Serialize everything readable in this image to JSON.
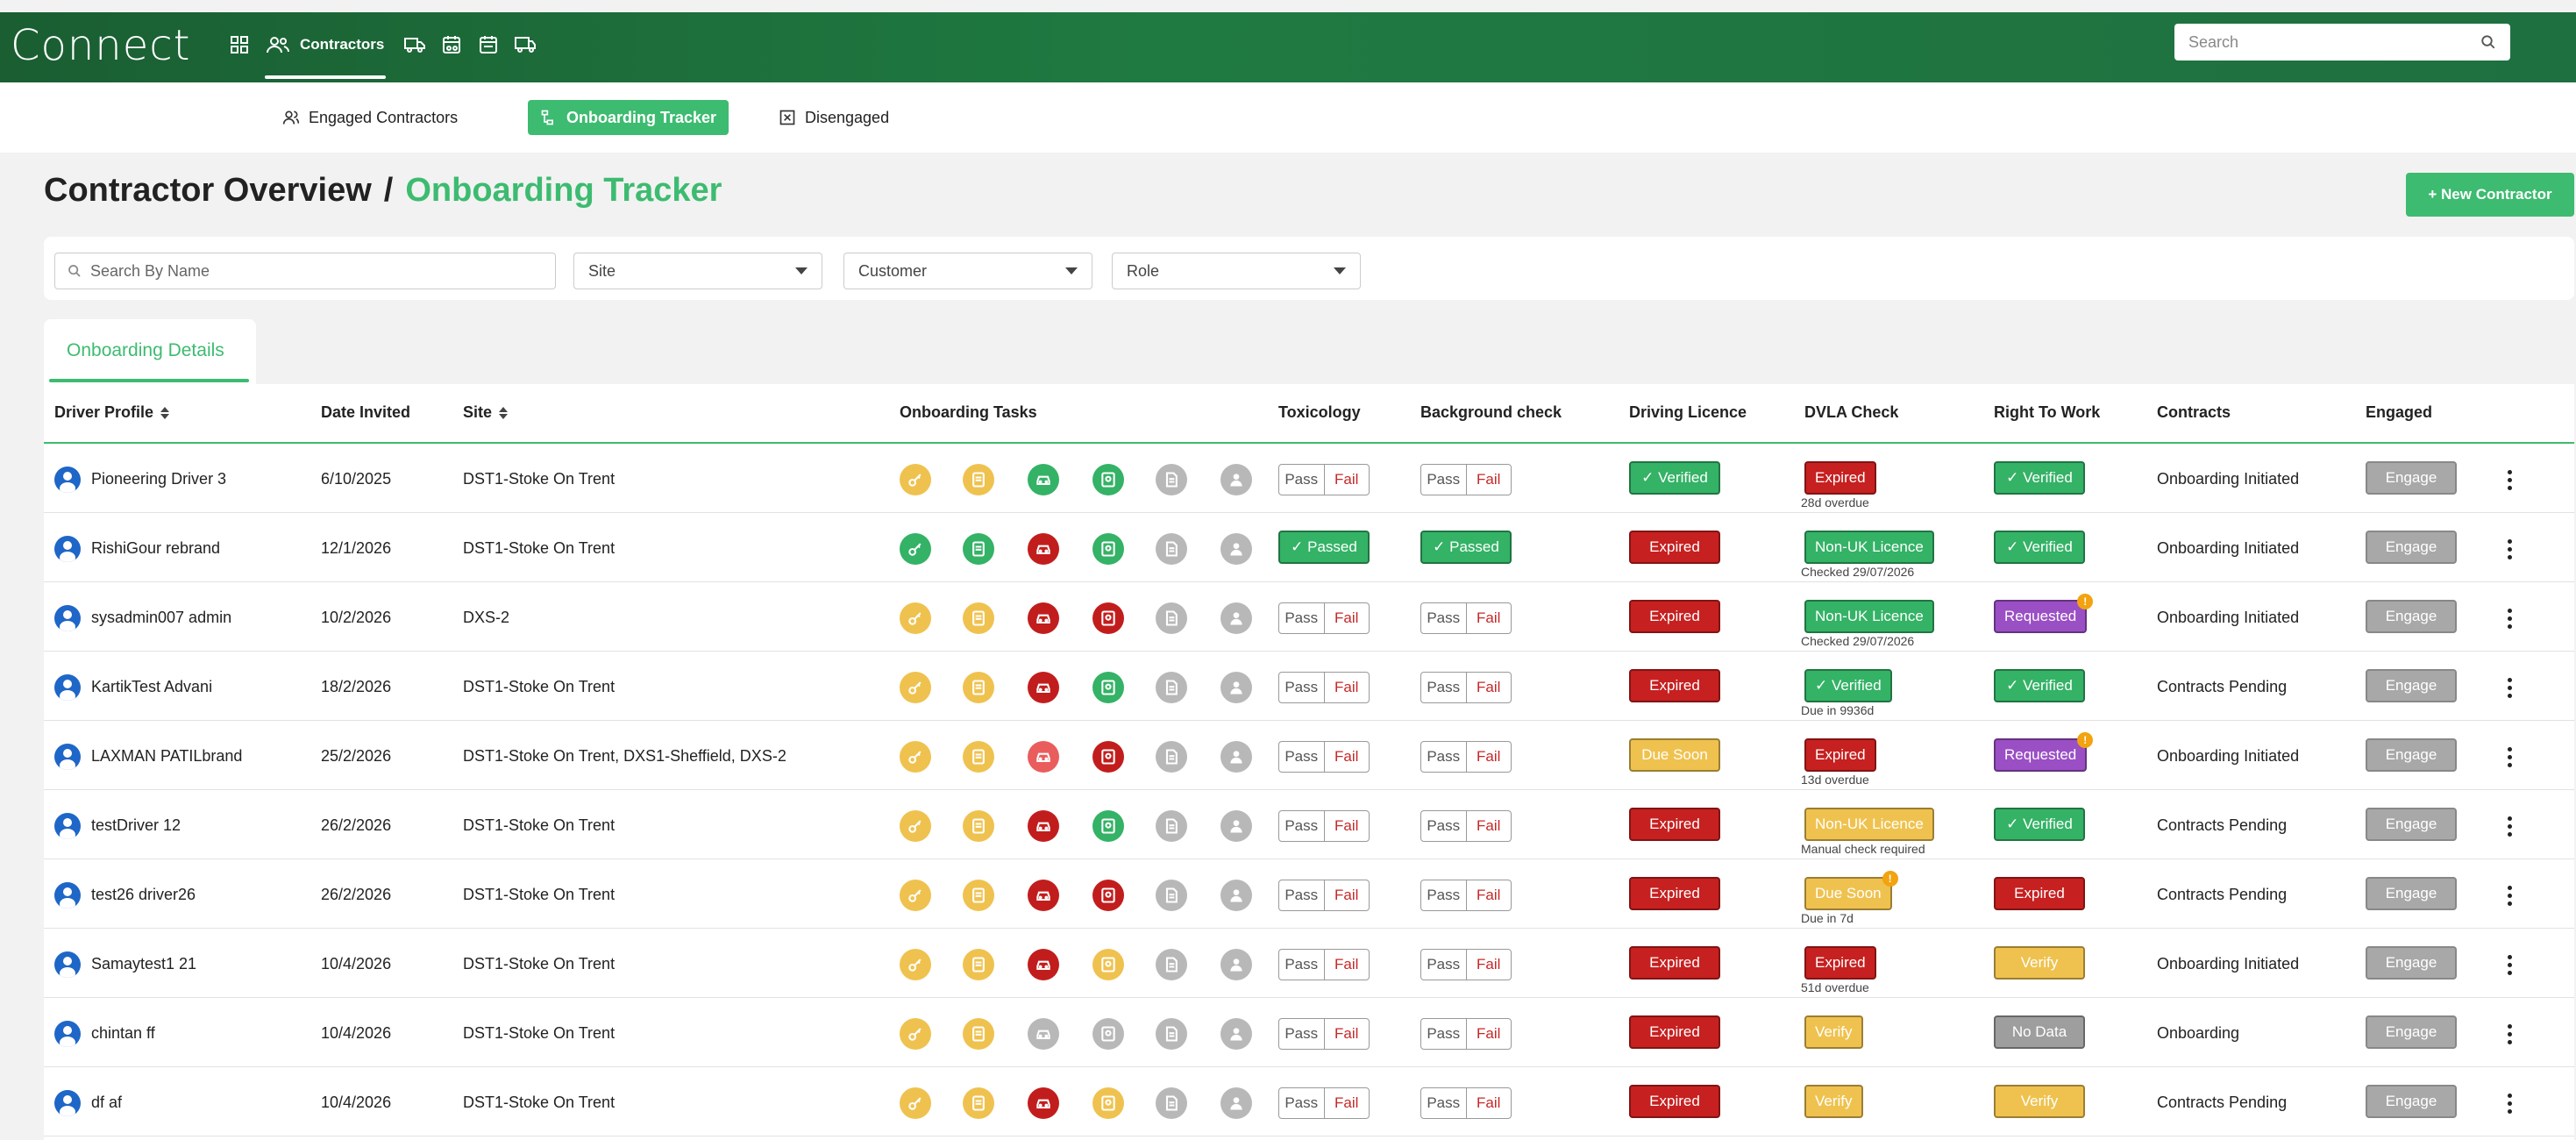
{
  "app": {
    "logo": "Connect",
    "nav_active_label": "Contractors",
    "search_placeholder": "Search",
    "nav_icons": [
      "grid-icon",
      "contractors-icon",
      "truck-icon",
      "calendar-truck-icon",
      "fleet-calendar-icon",
      "delivery-truck-icon"
    ]
  },
  "subnav": {
    "tabs": [
      {
        "label": "Engaged Contractors",
        "icon": "users-icon"
      },
      {
        "label": "Onboarding Tracker",
        "icon": "tracker-icon",
        "active": true
      },
      {
        "label": "Disengaged",
        "icon": "close-box-icon"
      }
    ]
  },
  "heading": {
    "parent": "Contractor Overview",
    "separator": "/",
    "current": "Onboarding Tracker"
  },
  "new_contractor_label": "+ New Contractor",
  "filters": {
    "search_placeholder": "Search By Name",
    "site": "Site",
    "customer": "Customer",
    "role": "Role"
  },
  "details_tab": "Onboarding Details",
  "columns": {
    "driver_profile": "Driver Profile",
    "date_invited": "Date Invited",
    "site": "Site",
    "onboarding_tasks": "Onboarding Tasks",
    "toxicology": "Toxicology",
    "background_check": "Background check",
    "driving_licence": "Driving Licence",
    "dvla_check": "DVLA Check",
    "right_to_work": "Right To Work",
    "contracts": "Contracts",
    "engaged": "Engaged"
  },
  "labels": {
    "pass": "Pass",
    "fail": "Fail",
    "engage": "Engage"
  },
  "colors": {
    "green": "#34b266",
    "red": "#c62020",
    "yellow": "#efc24f",
    "grey": "#b0b0b0",
    "brand": "#1f7a41",
    "accent": "#3dbb70"
  },
  "rows": [
    {
      "name": "Pioneering Driver 3",
      "date": "6/10/2025",
      "site": "DST1-Stoke On Trent",
      "tasks": [
        "yellow",
        "yellow",
        "green",
        "green",
        "grey",
        "grey"
      ],
      "toxicology": null,
      "background": null,
      "licence": {
        "text": "✓ Verified",
        "color": "green"
      },
      "dvla": {
        "text": "Expired",
        "color": "red",
        "sub": "28d overdue"
      },
      "rtw": {
        "text": "✓ Verified",
        "color": "green"
      },
      "contracts": "Onboarding Initiated"
    },
    {
      "name": "RishiGour rebrand",
      "date": "12/1/2026",
      "site": "DST1-Stoke On Trent",
      "tasks": [
        "green",
        "green",
        "red",
        "green",
        "grey",
        "grey"
      ],
      "toxicology": "✓ Passed",
      "background": "✓ Passed",
      "licence": {
        "text": "Expired",
        "color": "red"
      },
      "dvla": {
        "text": "Non-UK Licence",
        "color": "green",
        "sub": "Checked 29/07/2026"
      },
      "rtw": {
        "text": "✓ Verified",
        "color": "green"
      },
      "contracts": "Onboarding Initiated"
    },
    {
      "name": "sysadmin007 admin",
      "date": "10/2/2026",
      "site": "DXS-2",
      "tasks": [
        "yellow",
        "yellow",
        "red",
        "red",
        "grey",
        "grey"
      ],
      "toxicology": null,
      "background": null,
      "licence": {
        "text": "Expired",
        "color": "red"
      },
      "dvla": {
        "text": "Non-UK Licence",
        "color": "green",
        "sub": "Checked 29/07/2026"
      },
      "rtw": {
        "text": "Requested",
        "color": "purple",
        "warn": "!"
      },
      "contracts": "Onboarding Initiated"
    },
    {
      "name": "KartikTest Advani",
      "date": "18/2/2026",
      "site": "DST1-Stoke On Trent",
      "tasks": [
        "yellow",
        "yellow",
        "red",
        "green",
        "grey",
        "grey"
      ],
      "toxicology": null,
      "background": null,
      "licence": {
        "text": "Expired",
        "color": "red"
      },
      "dvla": {
        "text": "✓ Verified",
        "color": "green",
        "sub": "Due in 9936d"
      },
      "rtw": {
        "text": "✓ Verified",
        "color": "green"
      },
      "contracts": "Contracts Pending"
    },
    {
      "name": "LAXMAN PATILbrand",
      "date": "25/2/2026",
      "site": "DST1-Stoke On Trent, DXS1-Sheffield, DXS-2",
      "tasks": [
        "yellow",
        "yellow",
        "lightred",
        "red",
        "grey",
        "grey"
      ],
      "toxicology": null,
      "background": null,
      "licence": {
        "text": "Due Soon",
        "color": "yellow"
      },
      "dvla": {
        "text": "Expired",
        "color": "red",
        "sub": "13d overdue"
      },
      "rtw": {
        "text": "Requested",
        "color": "purple",
        "warn": "!"
      },
      "contracts": "Onboarding Initiated"
    },
    {
      "name": "testDriver 12",
      "date": "26/2/2026",
      "site": "DST1-Stoke On Trent",
      "tasks": [
        "yellow",
        "yellow",
        "red",
        "green",
        "grey",
        "grey"
      ],
      "toxicology": null,
      "background": null,
      "licence": {
        "text": "Expired",
        "color": "red"
      },
      "dvla": {
        "text": "Non-UK Licence",
        "color": "yellow",
        "sub": "Manual check required"
      },
      "rtw": {
        "text": "✓ Verified",
        "color": "green"
      },
      "contracts": "Contracts Pending"
    },
    {
      "name": "test26 driver26",
      "date": "26/2/2026",
      "site": "DST1-Stoke On Trent",
      "tasks": [
        "yellow",
        "yellow",
        "red",
        "red",
        "grey",
        "grey"
      ],
      "toxicology": null,
      "background": null,
      "licence": {
        "text": "Expired",
        "color": "red"
      },
      "dvla": {
        "text": "Due Soon",
        "color": "yellow",
        "sub": "Due in 7d",
        "warn": "!"
      },
      "rtw": {
        "text": "Expired",
        "color": "red"
      },
      "contracts": "Contracts Pending"
    },
    {
      "name": "Samaytest1 21",
      "date": "10/4/2026",
      "site": "DST1-Stoke On Trent",
      "tasks": [
        "yellow",
        "yellow",
        "red",
        "yellow",
        "grey",
        "grey"
      ],
      "toxicology": null,
      "background": null,
      "licence": {
        "text": "Expired",
        "color": "red"
      },
      "dvla": {
        "text": "Expired",
        "color": "red",
        "sub": "51d overdue"
      },
      "rtw": {
        "text": "Verify",
        "color": "yellow"
      },
      "contracts": "Onboarding Initiated"
    },
    {
      "name": "chintan ff",
      "date": "10/4/2026",
      "site": "DST1-Stoke On Trent",
      "tasks": [
        "yellow",
        "yellow",
        "grey",
        "grey",
        "grey",
        "grey"
      ],
      "toxicology": null,
      "background": null,
      "licence": {
        "text": "Expired",
        "color": "red"
      },
      "dvla": {
        "text": "Verify",
        "color": "yellow"
      },
      "rtw": {
        "text": "No Data",
        "color": "grey"
      },
      "contracts": "Onboarding"
    },
    {
      "name": "df af",
      "date": "10/4/2026",
      "site": "DST1-Stoke On Trent",
      "tasks": [
        "yellow",
        "yellow",
        "red",
        "yellow",
        "grey",
        "grey"
      ],
      "toxicology": null,
      "background": null,
      "licence": {
        "text": "Expired",
        "color": "red"
      },
      "dvla": {
        "text": "Verify",
        "color": "yellow"
      },
      "rtw": {
        "text": "Verify",
        "color": "yellow"
      },
      "contracts": "Contracts Pending"
    }
  ]
}
